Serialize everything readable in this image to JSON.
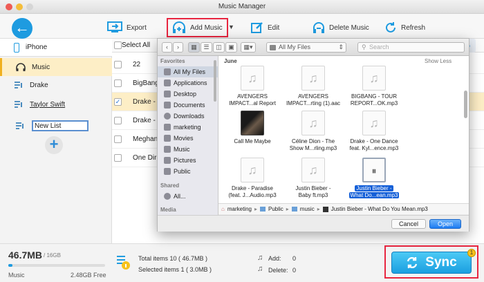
{
  "window": {
    "title": "Music Manager"
  },
  "toolbar": {
    "export": "Export",
    "add_music": "Add Music",
    "edit": "Edit",
    "delete_music": "Delete Music",
    "refresh": "Refresh"
  },
  "sidebar": {
    "device": "iPhone",
    "items": [
      {
        "label": "Music"
      },
      {
        "label": "Drake"
      },
      {
        "label": "Taylor Swift"
      }
    ],
    "new_list_value": "New List"
  },
  "list": {
    "select_all": "Select All",
    "rows": [
      {
        "name": "22",
        "checked": false
      },
      {
        "name": "BigBang",
        "checked": false
      },
      {
        "name": "Drake - C",
        "checked": true
      },
      {
        "name": "Drake - P",
        "checked": false
      },
      {
        "name": "Meghan",
        "checked": false
      },
      {
        "name": "One Direc",
        "checked": false
      }
    ]
  },
  "dialog": {
    "location": "All My Files",
    "search_placeholder": "Search",
    "section": "June",
    "show_less": "Show Less",
    "favorites_header": "Favorites",
    "favorites": [
      "All My Files",
      "Applications",
      "Desktop",
      "Documents",
      "Downloads",
      "marketing",
      "Movies",
      "Music",
      "Pictures",
      "Public"
    ],
    "shared_header": "Shared",
    "shared": [
      "All..."
    ],
    "media_header": "Media",
    "files": [
      {
        "line1": "AVENGERS",
        "line2": "IMPACT...al Report"
      },
      {
        "line1": "AVENGERS",
        "line2": "IMPACT...rting (1).aac"
      },
      {
        "line1": "BIGBANG - TOUR",
        "line2": "REPORT...OK.mp3"
      },
      {
        "line1": "Call Me Maybe",
        "line2": ""
      },
      {
        "line1": "Céline Dion - The",
        "line2": "Show M...rling.mp3"
      },
      {
        "line1": "Drake - One Dance",
        "line2": "feat. Kyl...ence.mp3"
      },
      {
        "line1": "Drake - Paradise",
        "line2": "(feat. J...Audio.mp3"
      },
      {
        "line1": "Justin Bieber -",
        "line2": "Baby ft.mp3"
      },
      {
        "line1": "Justin Bieber -",
        "line2": "What Do...ean.mp3"
      }
    ],
    "path": [
      "marketing",
      "Public",
      "music",
      "Justin Bieber - What Do You Mean.mp3"
    ],
    "cancel": "Cancel",
    "open": "Open"
  },
  "bottom": {
    "used": "46.7MB",
    "total": "/ 16GB",
    "category": "Music",
    "free": "2.48GB Free",
    "total_items": "Total items 10 ( 46.7MB )",
    "selected_items": "Selected items 1 ( 3.0MB )",
    "add_label": "Add:",
    "add_value": "0",
    "delete_label": "Delete:",
    "delete_value": "0"
  },
  "sync": {
    "label": "Sync",
    "badge": "1"
  },
  "colors": {
    "accent": "#1e9be0",
    "highlight": "#e8253f",
    "selection": "#fdeec6",
    "finder_select": "#1560d8"
  }
}
